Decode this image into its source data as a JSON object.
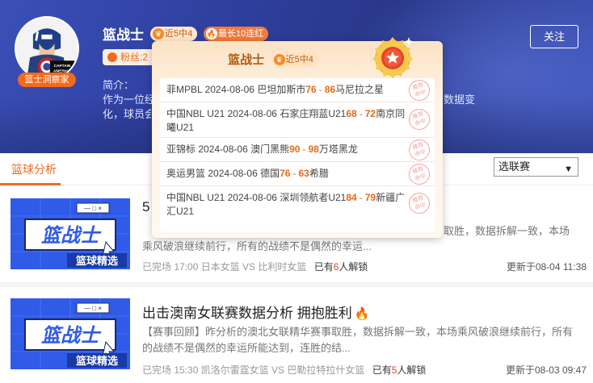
{
  "author": {
    "name": "篮战士",
    "avatar_tag": "篮士洞察家",
    "badge_recent": "近5中4",
    "badge_streak": "最长10连红",
    "fans": "粉丝:2",
    "intro_label": "简介：",
    "intro_line1_start": "作为一位经",
    "intro_line1_end": "数据变",
    "intro_line2_start": "化，球员会"
  },
  "follow_button": "关注",
  "tabs": {
    "active": "篮球分析",
    "league_select": "选联赛"
  },
  "popup": {
    "name": "篮战士",
    "badge": "近5中4",
    "records": [
      {
        "league": "菲MPBL",
        "date": "2024-08-06",
        "home": "巴坦加斯市",
        "home_score": "76",
        "away_score": "86",
        "away": "马尼拉之星",
        "stamp": "命中"
      },
      {
        "league": "中国NBL U21",
        "date": "2024-08-06",
        "home": "石家庄翔蓝U21",
        "home_score": "68",
        "away_score": "72",
        "away": "南京同曦U21",
        "stamp": "命中"
      },
      {
        "league": "亚锦标",
        "date": "2024-08-06",
        "home": "澳门黑熊",
        "home_score": "90",
        "away_score": "98",
        "away": "万塔黑龙",
        "stamp": "命中"
      },
      {
        "league": "奥运男篮",
        "date": "2024-08-06",
        "home": "德国",
        "home_score": "76",
        "away_score": "63",
        "away": "希腊",
        "stamp": "命中"
      },
      {
        "league": "中国NBL U21",
        "date": "2024-08-06",
        "home": "深圳领航者U21",
        "home_score": "84",
        "away_score": "79",
        "away": "新疆广汇U21",
        "stamp": "命中"
      }
    ]
  },
  "articles": [
    {
      "title": "5",
      "desc_right": "取胜，数据拆解一致，本场",
      "desc_line2": "乘风破浪继续前行，所有的战绩不是偶然的幸运...",
      "meta": "已完场 17:00 日本女篮 VS 比利时女篮",
      "unlock_pre": "已有",
      "unlock_count": "6",
      "unlock_post": "人解锁",
      "updated": "更新于08-04 11:38",
      "thumb_title": "篮战士",
      "thumb_sub": "篮球精选"
    },
    {
      "title": "出击澳南女联赛数据分析 拥抱胜利",
      "desc": "【赛事回顾】昨分析的澳北女联精华赛事取胜，数据拆解一致，本场乘风破浪继续前行，所有的战绩不是偶然的幸运所能达到，连胜的结...",
      "meta": "已完场 15:30 凯洛尔雷霆女篮 VS 巴勒拉特拉什女篮",
      "unlock_pre": "已有",
      "unlock_count": "5",
      "unlock_post": "人解锁",
      "updated": "更新于08-03 09:47",
      "thumb_title": "篮战士",
      "thumb_sub": "篮球精选"
    }
  ]
}
